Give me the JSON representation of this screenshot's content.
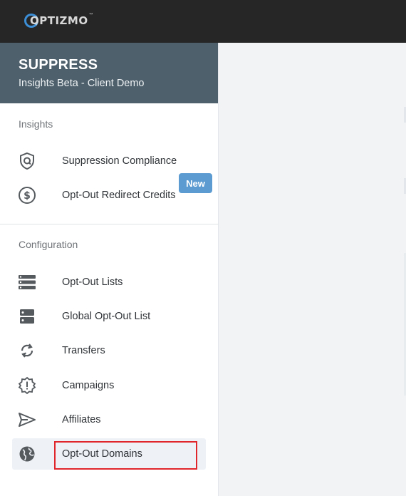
{
  "app": {
    "logo_text": "OPTIZMO",
    "logo_tm": "™"
  },
  "sidebar": {
    "title": "SUPPRESS",
    "subtitle": "Insights Beta - Client Demo",
    "sections": [
      {
        "label": "Insights",
        "items": [
          {
            "label": "Suppression Compliance",
            "icon": "shield-icon"
          },
          {
            "label": "Opt-Out Redirect Credits",
            "icon": "dollar-circle-icon",
            "badge": "New"
          }
        ]
      },
      {
        "label": "Configuration",
        "items": [
          {
            "label": "Opt-Out Lists",
            "icon": "list-server-icon"
          },
          {
            "label": "Global Opt-Out List",
            "icon": "server-icon"
          },
          {
            "label": "Transfers",
            "icon": "sync-icon"
          },
          {
            "label": "Campaigns",
            "icon": "alert-badge-icon"
          },
          {
            "label": "Affiliates",
            "icon": "send-icon"
          },
          {
            "label": "Opt-Out Domains",
            "icon": "globe-icon",
            "active": true
          }
        ]
      }
    ]
  },
  "colors": {
    "topbar": "#262626",
    "sidebar_header": "#4e606c",
    "badge": "#5b9bd1",
    "highlight": "#e0252b",
    "logo_ring": "#3c8fd6"
  }
}
